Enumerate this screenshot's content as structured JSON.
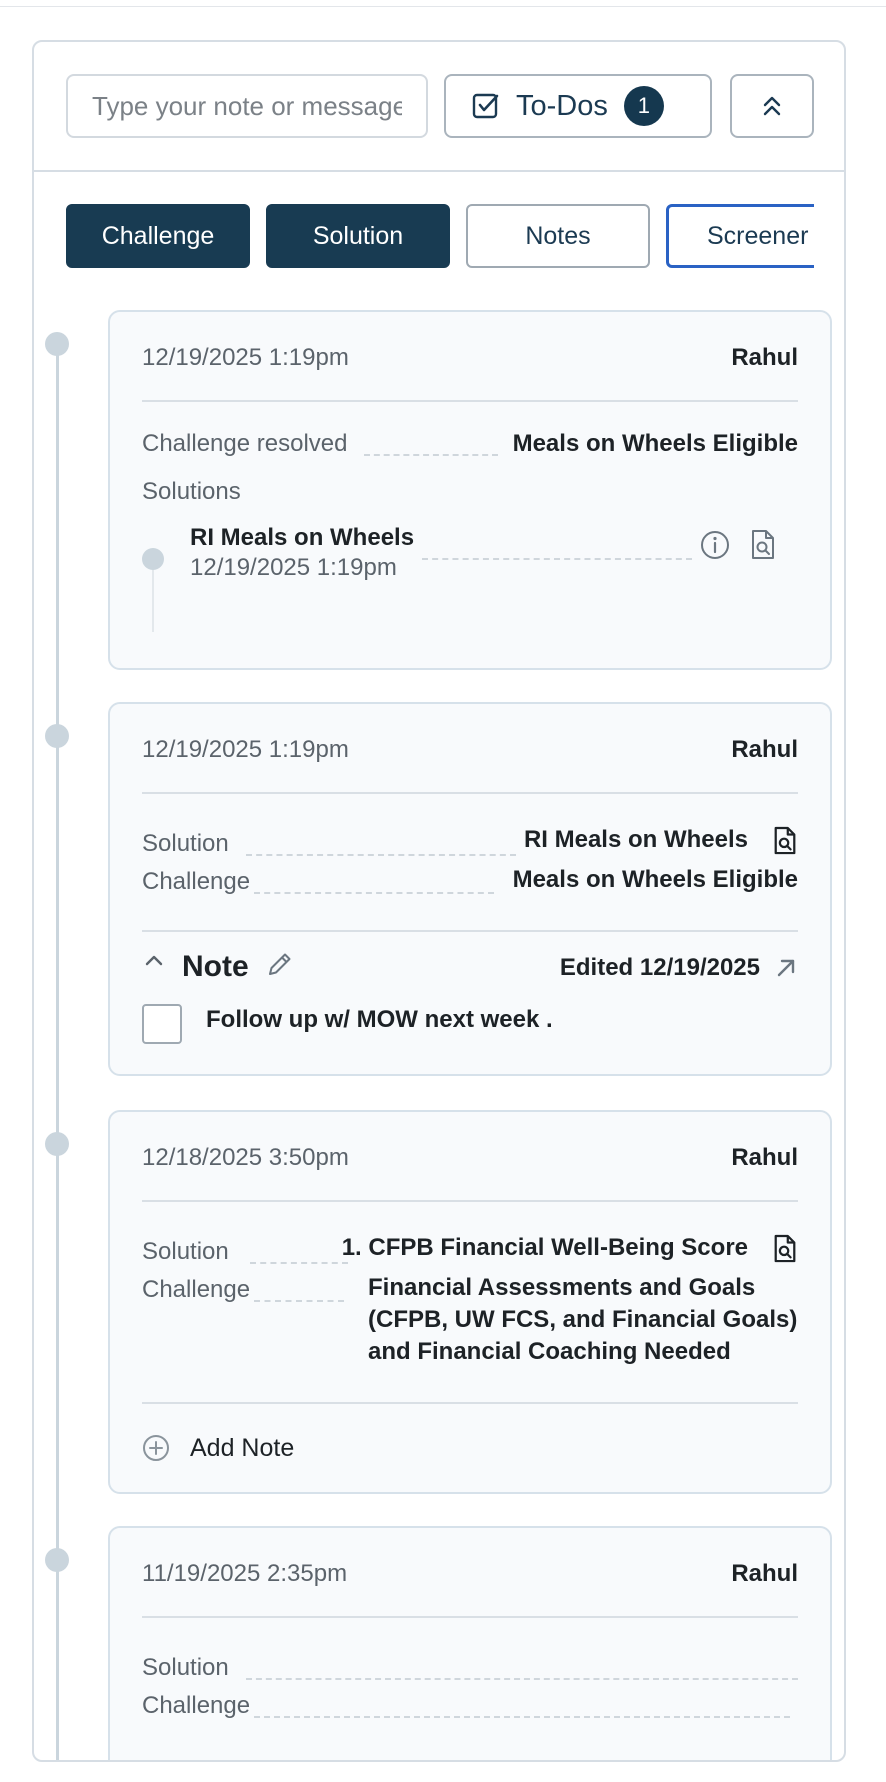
{
  "composer": {
    "placeholder": "Type your note or message",
    "todos_label": "To-Dos",
    "todos_count": "1"
  },
  "filters": [
    "Challenge",
    "Solution",
    "Notes",
    "Screener"
  ],
  "cards": [
    {
      "timestamp": "12/19/2025 1:19pm",
      "author": "Rahul",
      "challenge_label": "Challenge resolved",
      "challenge_value": "Meals on Wheels Eligible",
      "solutions_heading": "Solutions",
      "solution_name": "RI Meals on Wheels",
      "solution_date": "12/19/2025 1:19pm"
    },
    {
      "timestamp": "12/19/2025 1:19pm",
      "author": "Rahul",
      "solution_label": "Solution",
      "solution_value": "RI Meals on Wheels",
      "challenge_label": "Challenge",
      "challenge_value": "Meals on Wheels Eligible",
      "note_title": "Note",
      "edited": "Edited 12/19/2025",
      "note_text": "Follow up w/ MOW next week ."
    },
    {
      "timestamp": "12/18/2025 3:50pm",
      "author": "Rahul",
      "solution_label": "Solution",
      "solution_value": "1. CFPB Financial Well-Being Score",
      "challenge_label": "Challenge",
      "challenge_lines": [
        "Financial Assessments and Goals",
        "(CFPB, UW FCS, and Financial Goals)",
        "and Financial Coaching Needed"
      ],
      "add_note": "Add Note"
    },
    {
      "timestamp": "11/19/2025 2:35pm",
      "author": "Rahul",
      "solution_label": "Solution",
      "challenge_label": "Challenge"
    }
  ],
  "colors": {
    "primary": "#183b52",
    "focus": "#2a62c4",
    "border": "#d6dde4",
    "card_bg": "#f8fafc"
  }
}
